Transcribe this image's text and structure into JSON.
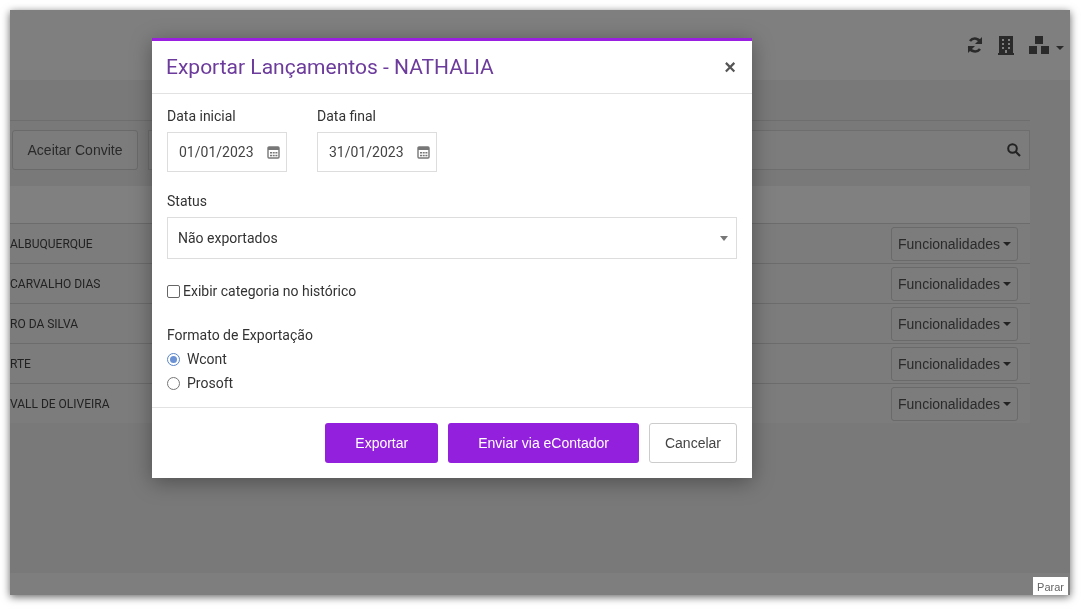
{
  "background": {
    "accept_button": "Aceitar Convite",
    "rows": [
      {
        "name": "ALBUQUERQUE",
        "action": "Funcionalidades"
      },
      {
        "name": "CARVALHO DIAS",
        "action": "Funcionalidades"
      },
      {
        "name": "RO DA SILVA",
        "action": "Funcionalidades"
      },
      {
        "name": "RTE",
        "action": "Funcionalidades"
      },
      {
        "name": "VALL DE OLIVEIRA",
        "action": "Funcionalidades"
      }
    ],
    "stop_button": "Parar"
  },
  "dialog": {
    "title": "Exportar Lançamentos - NATHALIA",
    "close": "×",
    "start_date": {
      "label": "Data inicial",
      "value": "01/01/2023"
    },
    "end_date": {
      "label": "Data final",
      "value": "31/01/2023"
    },
    "status": {
      "label": "Status",
      "value": "Não exportados"
    },
    "show_category": {
      "label": "Exibir categoria no histórico",
      "checked": false
    },
    "format": {
      "label": "Formato de Exportação",
      "options": [
        {
          "label": "Wcont",
          "selected": true
        },
        {
          "label": "Prosoft",
          "selected": false
        }
      ]
    },
    "buttons": [
      {
        "label": "Exportar",
        "kind": "primary"
      },
      {
        "label": "Enviar via eContador",
        "kind": "primary"
      },
      {
        "label": "Cancelar",
        "kind": "default"
      }
    ]
  }
}
